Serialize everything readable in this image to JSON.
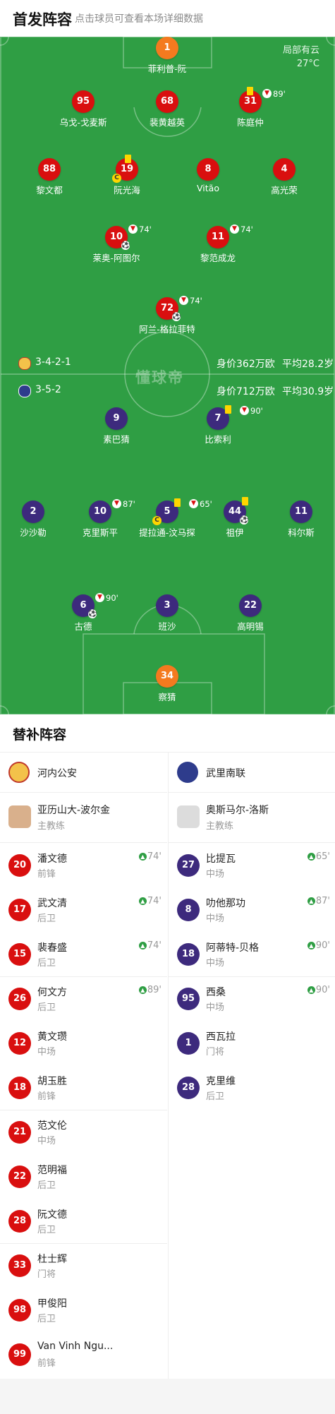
{
  "header": {
    "title": "首发阵容",
    "subtitle": "点击球员可查看本场详细数据"
  },
  "weather": {
    "condition": "局部有云",
    "temp": "27°C"
  },
  "watermark": "懂球帝",
  "home": {
    "formation": "3-4-2-1",
    "value": "身价362万欧",
    "age": "平均28.2岁",
    "color": "#d90f0f"
  },
  "away": {
    "formation": "3-5-2",
    "value": "身价712万欧",
    "age": "平均30.9岁",
    "color": "#3d2a7d"
  },
  "players": [
    {
      "num": "1",
      "name": "菲利普-阮",
      "team": "gk-home"
    },
    {
      "num": "95",
      "name": "乌戈-戈麦斯",
      "team": "home"
    },
    {
      "num": "68",
      "name": "裴黄越英",
      "team": "home"
    },
    {
      "num": "31",
      "name": "陈庭仲",
      "team": "home",
      "sub": "89'"
    },
    {
      "num": "88",
      "name": "黎文都",
      "team": "home"
    },
    {
      "num": "19",
      "name": "阮光海",
      "team": "home"
    },
    {
      "num": "8",
      "name": "Vitão",
      "team": "home"
    },
    {
      "num": "4",
      "name": "高光荣",
      "team": "home"
    },
    {
      "num": "10",
      "name": "莱奥-阿图尔",
      "team": "home",
      "sub": "74'"
    },
    {
      "num": "11",
      "name": "黎范成龙",
      "team": "home",
      "sub": "74'"
    },
    {
      "num": "72",
      "name": "阿兰-格拉菲特",
      "team": "home",
      "sub": "74'"
    },
    {
      "num": "9",
      "name": "素巴猜",
      "team": "away"
    },
    {
      "num": "7",
      "name": "比索利",
      "team": "away",
      "sub": "90'"
    },
    {
      "num": "2",
      "name": "沙沙勒",
      "team": "away"
    },
    {
      "num": "10",
      "name": "克里斯平",
      "team": "away",
      "sub": "87'"
    },
    {
      "num": "5",
      "name": "提拉通-汶马探",
      "team": "away",
      "sub": "65'"
    },
    {
      "num": "44",
      "name": "祖伊",
      "team": "away"
    },
    {
      "num": "11",
      "name": "科尔斯",
      "team": "away"
    },
    {
      "num": "6",
      "name": "古德",
      "team": "away",
      "sub": "90'"
    },
    {
      "num": "3",
      "name": "班沙",
      "team": "away"
    },
    {
      "num": "22",
      "name": "高明锡",
      "team": "away"
    },
    {
      "num": "34",
      "name": "察猜",
      "team": "gk-away"
    }
  ],
  "icons": {
    "captain": "C",
    "ball": "⚽",
    "sub_out": "sub-out-icon",
    "sub_in": "sub-in-icon",
    "yellow": "yellow-card-icon"
  },
  "bench": {
    "title": "替补阵容",
    "home": {
      "team": "河内公安",
      "coach": {
        "name": "亚历山大-波尔金",
        "role": "主教练"
      },
      "players": [
        {
          "num": "20",
          "name": "潘文德",
          "pos": "前锋",
          "in": "74'"
        },
        {
          "num": "17",
          "name": "武文清",
          "pos": "后卫",
          "in": "74'"
        },
        {
          "num": "15",
          "name": "裴春盛",
          "pos": "后卫",
          "in": "74'"
        },
        {
          "num": "26",
          "name": "何文方",
          "pos": "后卫",
          "in": "89'"
        },
        {
          "num": "12",
          "name": "黄文瓒",
          "pos": "中场",
          "in": ""
        },
        {
          "num": "18",
          "name": "胡玉胜",
          "pos": "前锋",
          "in": ""
        },
        {
          "num": "21",
          "name": "范文伦",
          "pos": "中场",
          "in": ""
        },
        {
          "num": "22",
          "name": "范明福",
          "pos": "后卫",
          "in": ""
        },
        {
          "num": "28",
          "name": "阮文德",
          "pos": "后卫",
          "in": ""
        },
        {
          "num": "33",
          "name": "杜士辉",
          "pos": "门将",
          "in": ""
        },
        {
          "num": "98",
          "name": "甲俊阳",
          "pos": "后卫",
          "in": ""
        },
        {
          "num": "99",
          "name": "Van Vinh Ngu...",
          "pos": "前锋",
          "in": ""
        }
      ]
    },
    "away": {
      "team": "武里南联",
      "coach": {
        "name": "奥斯马尔-洛斯",
        "role": "主教练"
      },
      "players": [
        {
          "num": "27",
          "name": "比提瓦",
          "pos": "中场",
          "in": "65'"
        },
        {
          "num": "8",
          "name": "叻他那功",
          "pos": "中场",
          "in": "87'"
        },
        {
          "num": "18",
          "name": "阿蒂特-贝格",
          "pos": "中场",
          "in": "90'"
        },
        {
          "num": "95",
          "name": "西桑",
          "pos": "中场",
          "in": "90'"
        },
        {
          "num": "1",
          "name": "西瓦拉",
          "pos": "门将",
          "in": ""
        },
        {
          "num": "28",
          "name": "克里维",
          "pos": "后卫",
          "in": ""
        }
      ]
    }
  }
}
